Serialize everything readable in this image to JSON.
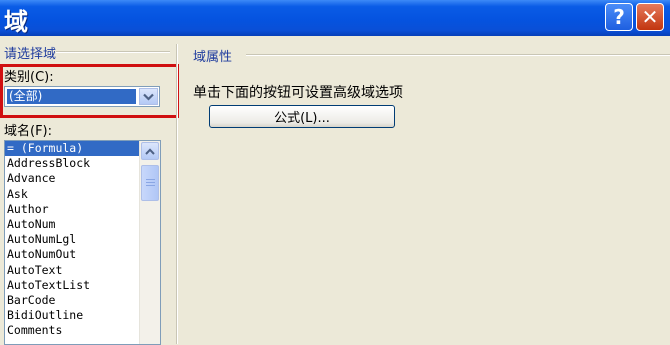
{
  "window": {
    "title": "域",
    "help_label": "?",
    "close_label": "✕"
  },
  "left": {
    "choose_field_label": "请选择域",
    "category_label": "类别(C):",
    "category_value": "(全部)",
    "field_names_label": "域名(F):",
    "field_names": [
      "= (Formula)",
      "AddressBlock",
      "Advance",
      "Ask",
      "Author",
      "AutoNum",
      "AutoNumLgl",
      "AutoNumOut",
      "AutoText",
      "AutoTextList",
      "BarCode",
      "BidiOutline",
      "Comments"
    ],
    "selected_index": 0
  },
  "right": {
    "field_properties_label": "域属性",
    "hint_text": "单击下面的按钮可设置高级域选项",
    "formula_button_label": "公式(L)..."
  },
  "icons": {
    "dropdown": "chevron-down-icon",
    "scroll_up": "arrow-up-icon"
  },
  "colors": {
    "title_bar": "#0553e0",
    "selection": "#316ac5",
    "highlight_box": "#d01010",
    "dialog_bg": "#ece9d8"
  }
}
